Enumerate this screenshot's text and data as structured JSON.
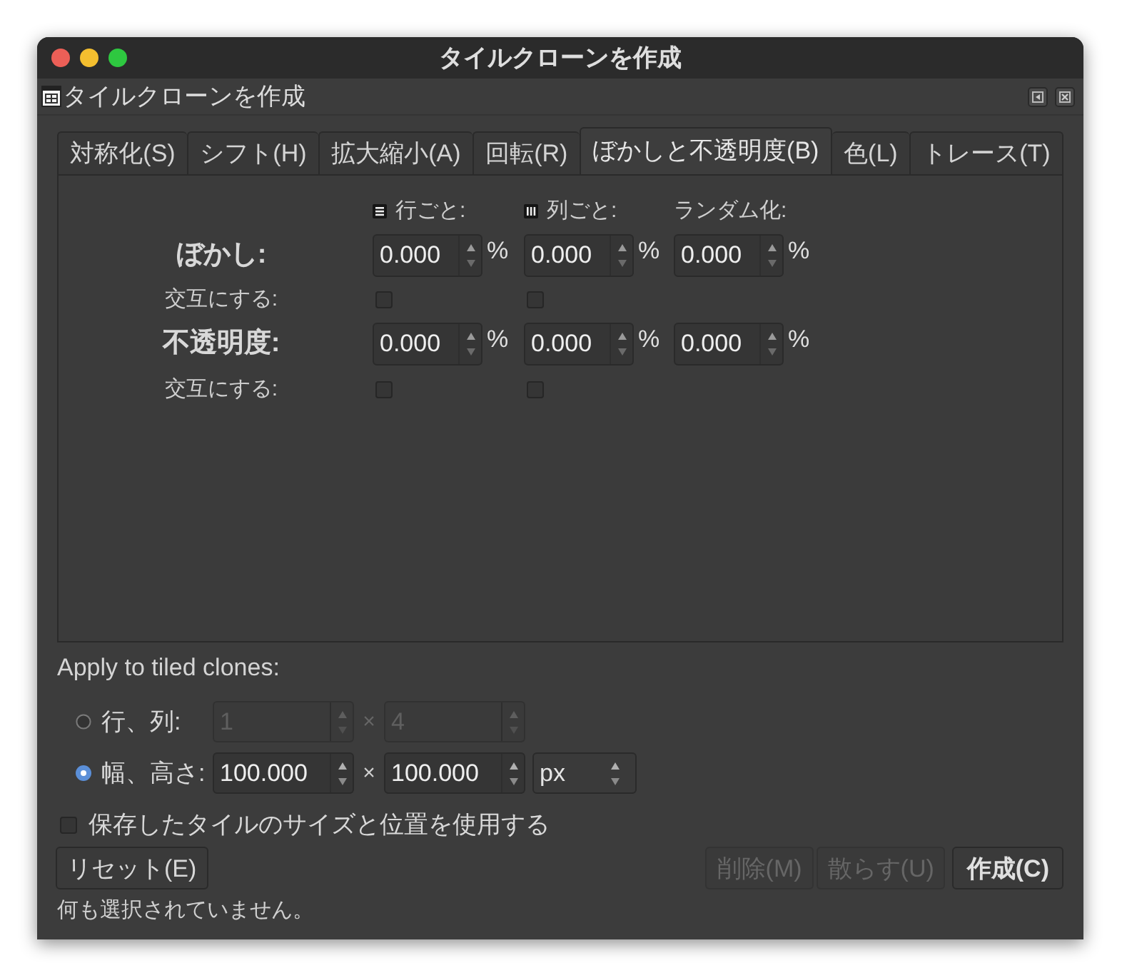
{
  "window": {
    "title": "タイルクローンを作成"
  },
  "dock": {
    "title": "タイルクローンを作成"
  },
  "tabs": [
    {
      "label": "対称化(S)",
      "selected": false
    },
    {
      "label": "シフト(H)",
      "selected": false
    },
    {
      "label": "拡大縮小(A)",
      "selected": false
    },
    {
      "label": "回転(R)",
      "selected": false
    },
    {
      "label": "ぼかしと不透明度(B)",
      "selected": true
    },
    {
      "label": "色(L)",
      "selected": false
    },
    {
      "label": "トレース(T)",
      "selected": false
    }
  ],
  "columns": [
    {
      "kind": "rows",
      "label": "行ごと:"
    },
    {
      "kind": "columns",
      "label": "列ごと:"
    },
    {
      "kind": "random",
      "label": "ランダム化:"
    }
  ],
  "sections": [
    {
      "label": "ぼかし:",
      "fields": [
        {
          "value": "0.000",
          "unit": "%"
        },
        {
          "value": "0.000",
          "unit": "%"
        },
        {
          "value": "0.000",
          "unit": "%"
        }
      ],
      "alternate": {
        "label": "交互にする:",
        "checks": [
          {
            "checked": false
          },
          {
            "checked": false
          }
        ]
      }
    },
    {
      "label": "不透明度:",
      "fields": [
        {
          "value": "0.000",
          "unit": "%"
        },
        {
          "value": "0.000",
          "unit": "%"
        },
        {
          "value": "0.000",
          "unit": "%"
        }
      ],
      "alternate": {
        "label": "交互にする:",
        "checks": [
          {
            "checked": false
          },
          {
            "checked": false
          }
        ]
      }
    }
  ],
  "apply": {
    "label": "Apply to tiled clones:",
    "options": [
      {
        "label": "行、列:",
        "selected": false,
        "fields": [
          "1",
          "4"
        ],
        "separator": "×"
      },
      {
        "label": "幅、高さ:",
        "selected": true,
        "fields": [
          "100.000",
          "100.000"
        ],
        "separator": "×",
        "unit": "px"
      }
    ]
  },
  "saved_size": {
    "label": "保存したタイルのサイズと位置を使用する",
    "checked": false
  },
  "buttons_left": [
    {
      "label": "リセット(E)",
      "disabled": false,
      "default": false
    }
  ],
  "buttons_right": [
    {
      "label": "削除(M)",
      "disabled": true,
      "default": false
    },
    {
      "label": "散らす(U)",
      "disabled": true,
      "default": false
    },
    {
      "label": "作成(C)",
      "disabled": false,
      "default": true
    }
  ],
  "status": "何も選択されていません。"
}
